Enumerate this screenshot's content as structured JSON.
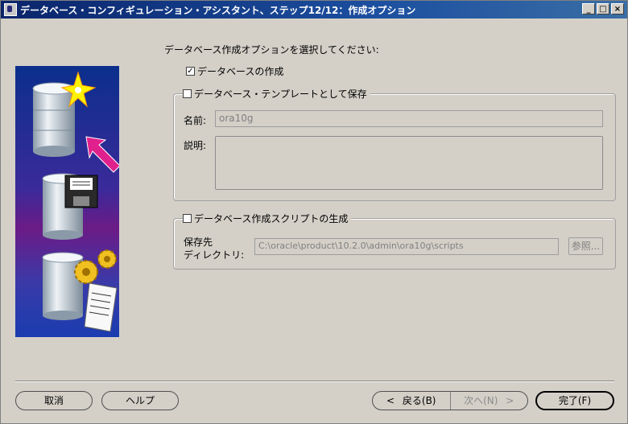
{
  "window": {
    "title": "データベース・コンフィギュレーション・アシスタント、ステップ12/12：作成オプション",
    "minimize_glyph": "_",
    "maximize_glyph": "□",
    "close_glyph": "×"
  },
  "prompt": "データベース作成オプションを選択してください:",
  "options": {
    "create_db": {
      "label": "データベースの作成",
      "checked": true,
      "mark": "✓"
    },
    "save_template": {
      "label": "データベース・テンプレートとして保存",
      "checked": false,
      "mark": ""
    },
    "gen_scripts": {
      "label": "データベース作成スクリプトの生成",
      "checked": false,
      "mark": ""
    }
  },
  "template_group": {
    "name_label": "名前:",
    "name_value": "ora10g",
    "desc_label": "説明:",
    "desc_value": ""
  },
  "script_group": {
    "dest_label_line1": "保存先",
    "dest_label_line2": "ディレクトリ:",
    "dest_value": "C:\\oracle\\product\\10.2.0\\admin\\ora10g\\scripts",
    "browse_label": "参照..."
  },
  "buttons": {
    "cancel": "取消",
    "help": "ヘルプ",
    "back": "戻る(B)",
    "back_arrow": "<",
    "next": "次へ(N)",
    "next_arrow": ">",
    "finish": "完了(F)"
  },
  "icons": [
    "app-icon",
    "database-create-icon",
    "database-save-icon",
    "database-script-icon",
    "star-icon",
    "arrow-icon",
    "floppy-icon",
    "gears-icon",
    "scroll-icon"
  ],
  "colors": {
    "title_bar": "#0a246a",
    "face": "#d4d0c8",
    "illustration_top": "#0b2f8c",
    "illustration_mid": "#6b1b86",
    "arrow": "#e0208c"
  }
}
